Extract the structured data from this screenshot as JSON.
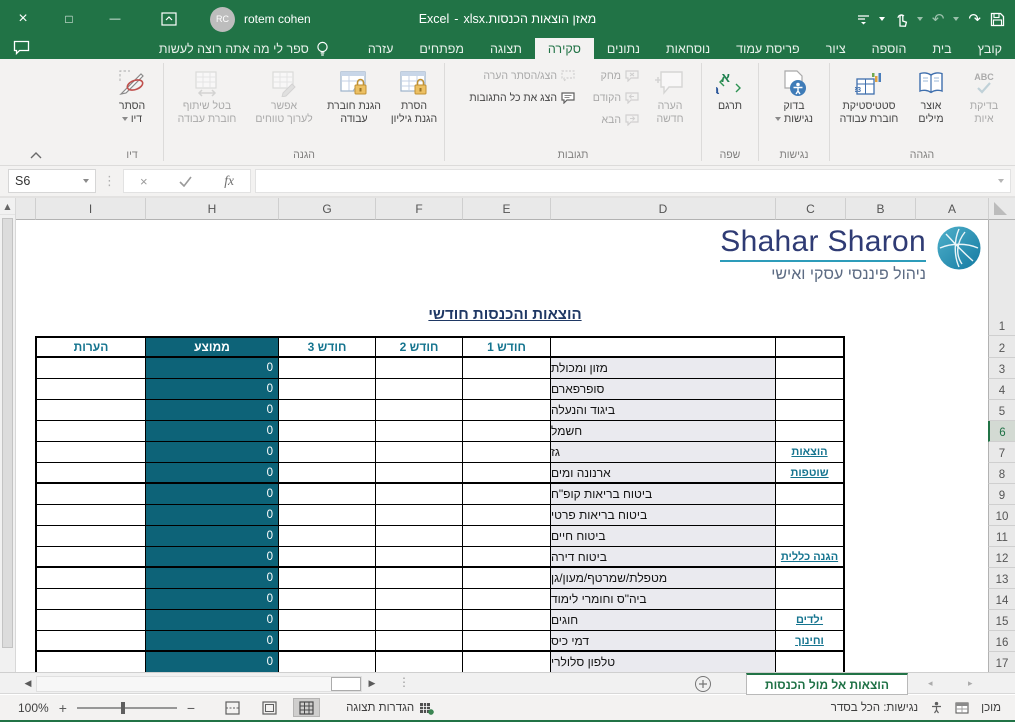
{
  "icons": {
    "close": "×",
    "maximize": "□",
    "minimize": "—",
    "undo": "↶",
    "redo": "↷",
    "dots_vertical": "⋮",
    "scroll_up": "▲",
    "scroll_left": "◀",
    "scroll_right": "▶",
    "nav_left": "◂",
    "nav_right": "▸"
  },
  "title_bar": {
    "app": "Excel",
    "separator": "-",
    "file": "מאזן הוצאות הכנסות.xlsx",
    "user": "rotem cohen",
    "initials": "RC"
  },
  "tab_bar": {
    "tabs": [
      {
        "label": "קובץ",
        "active": false
      },
      {
        "label": "בית",
        "active": false
      },
      {
        "label": "הוספה",
        "active": false
      },
      {
        "label": "ציור",
        "active": false
      },
      {
        "label": "פריסת עמוד",
        "active": false
      },
      {
        "label": "נוסחאות",
        "active": false
      },
      {
        "label": "נתונים",
        "active": false
      },
      {
        "label": "סקירה",
        "active": true
      },
      {
        "label": "תצוגה",
        "active": false
      },
      {
        "label": "מפתחים",
        "active": false
      },
      {
        "label": "עזרה",
        "active": false
      }
    ],
    "tell_me": "ספר לי מה אתה רוצה לעשות"
  },
  "ribbon": {
    "group_proofing": "הגהה",
    "spelling_1": "בדיקת",
    "spelling_2": "איות",
    "thesaurus_1": "אוצר",
    "thesaurus_2": "מילים",
    "stats_1": "סטטיסטיקת",
    "stats_2": "חוברת עבודה",
    "group_accessibility": "נגישות",
    "check_access_1": "בדוק",
    "check_access_2": "נגישות",
    "group_language": "שפה",
    "translate": "תרגם",
    "group_comments": "תגובות",
    "new_comment_1": "הערה",
    "new_comment_2": "חדשה",
    "delete_comment": "מחק",
    "prev_comment": "הקודם",
    "next_comment": "הבא",
    "show_hide_comment": "הצג/הסתר הערה",
    "show_all_comments": "הצג את כל התגובות",
    "group_protection": "הגנה",
    "unprotect_sheet_1": "הסרת",
    "unprotect_sheet_2": "הגנת גיליון",
    "protect_wb_1": "הגנת חוברת",
    "protect_wb_2": "עבודה",
    "edit_ranges_1": "אפשר",
    "edit_ranges_2": "לערוך טווחים",
    "unshare_1": "בטל שיתוף",
    "unshare_2": "חוברת עבודה",
    "group_ink": "דיו",
    "hide_ink_1": "הסתר",
    "hide_ink_2": "דיו"
  },
  "formula_bar": {
    "name_box": "S6",
    "fx": "fx"
  },
  "sheet": {
    "columns": [
      "I",
      "H",
      "G",
      "F",
      "E",
      "D",
      "C",
      "B",
      "A"
    ],
    "selected_row": 6,
    "row_count": 17,
    "logo": {
      "name": "Shahar Sharon",
      "subtitle": "ניהול פיננסי עסקי ואישי"
    },
    "table": {
      "title": "הוצאות והכנסות חודשי",
      "headers": {
        "notes": "הערות",
        "average": "ממוצע",
        "month3": "חודש 3",
        "month2": "חודש 2",
        "month1": "חודש 1"
      },
      "rows": [
        {
          "n": "3",
          "label": "מזון ומכולת",
          "avg": "0",
          "side": "",
          "thick": false
        },
        {
          "n": "4",
          "label": "סופרפארם",
          "avg": "0",
          "side": "",
          "thick": false
        },
        {
          "n": "5",
          "label": "ביגוד והנעלה",
          "avg": "0",
          "side": "",
          "thick": false
        },
        {
          "n": "6",
          "label": "חשמל",
          "avg": "0",
          "side": "",
          "thick": false
        },
        {
          "n": "7",
          "label": "גז",
          "avg": "0",
          "side": "הוצאות",
          "thick": false
        },
        {
          "n": "8",
          "label": "ארנונה ומים",
          "avg": "0",
          "side": "שוטפות",
          "thick": true
        },
        {
          "n": "9",
          "label": "ביטוח בריאות קופ\"ח",
          "avg": "0",
          "side": "",
          "thick": false
        },
        {
          "n": "10",
          "label": "ביטוח בריאות פרטי",
          "avg": "0",
          "side": "",
          "thick": false
        },
        {
          "n": "11",
          "label": "ביטוח חיים",
          "avg": "0",
          "side": "",
          "thick": false
        },
        {
          "n": "12",
          "label": "ביטוח דירה",
          "avg": "0",
          "side": "הגנה כללית",
          "thick": true
        },
        {
          "n": "13",
          "label": "מטפלת/שמרטף/מעון/גן",
          "avg": "0",
          "side": "",
          "thick": false
        },
        {
          "n": "14",
          "label": "ביה\"ס וחומרי לימוד",
          "avg": "0",
          "side": "",
          "thick": false
        },
        {
          "n": "15",
          "label": "חוגים",
          "avg": "0",
          "side": "ילדים",
          "thick": false
        },
        {
          "n": "16",
          "label": "דמי כיס",
          "avg": "0",
          "side": "וחינוך",
          "thick": true
        },
        {
          "n": "17",
          "label": "טלפון סלולרי",
          "avg": "0",
          "side": "",
          "thick": false
        }
      ]
    }
  },
  "sheet_tab_bar": {
    "active_tab": "הוצאות אל מול הכנסות"
  },
  "status_bar": {
    "ready": "מוכן",
    "accessibility": "נגישות: הכל בסדר",
    "zoom": "100%",
    "zoom_in": "+",
    "zoom_out": "−",
    "view_settings": "הגדרות תצוגה"
  }
}
